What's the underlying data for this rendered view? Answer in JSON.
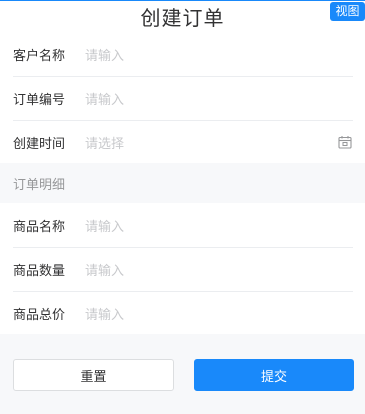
{
  "header": {
    "title": "创建订单",
    "view_badge": "视图"
  },
  "form": {
    "fields": [
      {
        "label": "客户名称",
        "placeholder": "请输入"
      },
      {
        "label": "订单编号",
        "placeholder": "请输入"
      },
      {
        "label": "创建时间",
        "placeholder": "请选择",
        "icon": "calendar-icon"
      }
    ]
  },
  "details": {
    "section_title": "订单明细",
    "fields": [
      {
        "label": "商品名称",
        "placeholder": "请输入"
      },
      {
        "label": "商品数量",
        "placeholder": "请输入"
      },
      {
        "label": "商品总价",
        "placeholder": "请输入"
      }
    ]
  },
  "actions": {
    "reset_label": "重置",
    "submit_label": "提交"
  },
  "colors": {
    "primary": "#1989fa",
    "placeholder": "#c8c9cc",
    "text": "#323233",
    "section": "#969799"
  }
}
